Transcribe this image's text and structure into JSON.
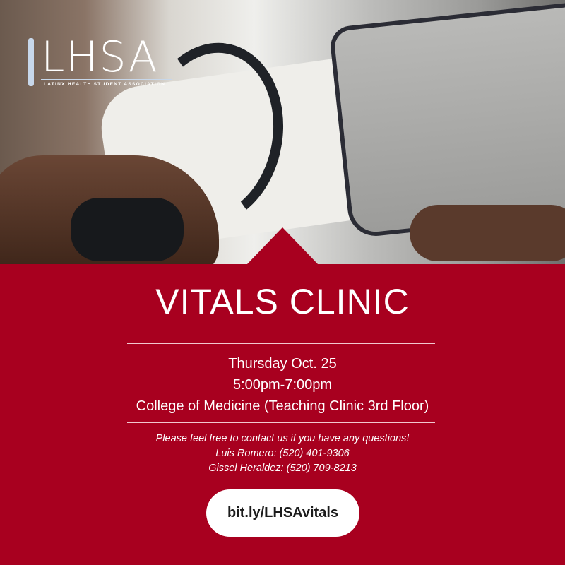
{
  "logo": {
    "wordmark": "LHSA",
    "subtitle": "LATINX HEALTH STUDENT ASSOCIATION"
  },
  "event": {
    "title": "VITALS CLINIC",
    "date": "Thursday Oct. 25",
    "time": "5:00pm-7:00pm",
    "location": "College of Medicine (Teaching Clinic 3rd Floor)"
  },
  "contact": {
    "intro": "Please feel free to contact us if you have any questions!",
    "people": [
      "Luis Romero: (520) 401-9306",
      "Gissel Heraldez: (520) 709-8213"
    ]
  },
  "link": {
    "label": "bit.ly/LHSAvitals"
  },
  "colors": {
    "brand_red": "#a8001f",
    "pill": "#ffffff"
  }
}
